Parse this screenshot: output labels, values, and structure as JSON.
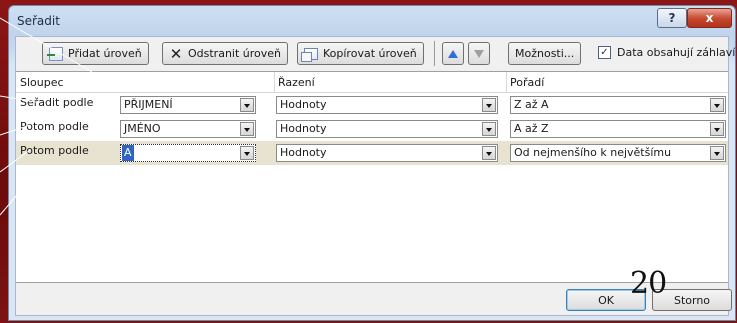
{
  "dialog": {
    "title": "Seřadit",
    "help_label": "?",
    "close_label": "x"
  },
  "toolbar": {
    "add_level": "Přidat úroveň",
    "remove_level": "Odstranit úroveň",
    "copy_level": "Kopírovat úroveň",
    "options": "Možnosti...",
    "header_checkbox_label": "Data obsahují záhlaví",
    "header_checkbox_checked": true
  },
  "grid": {
    "columns": [
      "Sloupec",
      "Řazení",
      "Pořadí"
    ],
    "rows": [
      {
        "label": "Seřadit podle",
        "column": "PŘIJMENÍ",
        "sort_on": "Hodnoty",
        "order": "Z až A"
      },
      {
        "label": "Potom podle",
        "column": "JMÉNO",
        "sort_on": "Hodnoty",
        "order": "A až Z"
      },
      {
        "label": "Potom podle",
        "column": "A",
        "sort_on": "Hodnoty",
        "order": "Od nejmenšího k největšímu"
      }
    ],
    "selected_row_index": 2
  },
  "footer": {
    "ok": "OK",
    "cancel": "Storno"
  },
  "slide": {
    "page_number": "20"
  },
  "colors": {
    "slide_background": "#7a0f0f",
    "selection_highlight": "#3063c7",
    "pointer_line": "#ffffff"
  }
}
